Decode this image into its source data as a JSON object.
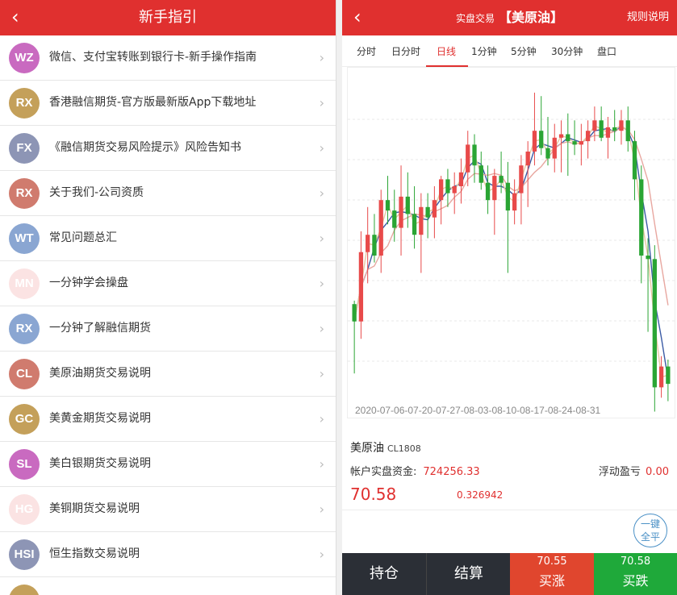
{
  "left": {
    "header": {
      "title": "新手指引"
    },
    "items": [
      {
        "abbr": "WZ",
        "color": "#c96ac0",
        "label": "微信、支付宝转账到银行卡-新手操作指南"
      },
      {
        "abbr": "RX",
        "color": "#c4a05a",
        "label": "香港融信期货-官方版最新版App下载地址"
      },
      {
        "abbr": "FX",
        "color": "#8d95b5",
        "label": "《融信期货交易风险提示》风险告知书"
      },
      {
        "abbr": "RX",
        "color": "#d07b6e",
        "label": "关于我们-公司资质"
      },
      {
        "abbr": "WT",
        "color": "#8aa6d2",
        "label": "常见问题总汇"
      },
      {
        "abbr": "MN",
        "color": "#fbe3e3",
        "label": "一分钟学会操盘"
      },
      {
        "abbr": "RX",
        "color": "#8aa6d2",
        "label": "一分钟了解融信期货"
      },
      {
        "abbr": "CL",
        "color": "#d07b6e",
        "label": "美原油期货交易说明"
      },
      {
        "abbr": "GC",
        "color": "#c4a05a",
        "label": "美黄金期货交易说明"
      },
      {
        "abbr": "SL",
        "color": "#c96ac0",
        "label": "美白银期货交易说明"
      },
      {
        "abbr": "HG",
        "color": "#fbe3e3",
        "label": "美铜期货交易说明"
      },
      {
        "abbr": "HSI",
        "color": "#8d95b5",
        "label": "恒生指数交易说明"
      },
      {
        "abbr": "",
        "color": "#c4a05a",
        "label": ""
      }
    ]
  },
  "right": {
    "header": {
      "prefix": "实盘交易",
      "product": "【美原油】",
      "rules": "规则说明"
    },
    "tabs": [
      "分时",
      "日分时",
      "日线",
      "1分钟",
      "5分钟",
      "30分钟",
      "盘口"
    ],
    "active_tab": "日线",
    "info": {
      "name": "美原油",
      "code": "CL1808",
      "funds_label": "帐户实盘资金:",
      "funds_value": "724256.33",
      "float_label": "浮动盈亏",
      "float_value": "0.00",
      "price": "70.58",
      "change": "0.326942",
      "close_all": [
        "一键",
        "全平"
      ]
    },
    "bottom": {
      "hold": "持仓",
      "settle": "结算",
      "buy_up_price": "70.55",
      "buy_up": "买涨",
      "buy_down_price": "70.58",
      "buy_down": "买跌"
    }
  },
  "chart_data": {
    "type": "candlestick",
    "x_axis_text": "2020-07-06-07-20-07-27-08-03-08-10-08-17-08-24-08-31",
    "colors": {
      "up": "#e84a4a",
      "down": "#2aa534",
      "ma_fast": "#3b5ba5",
      "ma_mid": "#e8a7a0",
      "ma_slow": "#e6c8a0"
    },
    "y_range": [
      34,
      43
    ],
    "candles": [
      [
        36.6,
        36.7,
        34.6,
        36.1
      ],
      [
        36.1,
        38.7,
        35.6,
        38.1
      ],
      [
        38.1,
        39.4,
        37.2,
        38.6
      ],
      [
        38.6,
        39.2,
        37.8,
        38.0
      ],
      [
        38.0,
        39.9,
        37.5,
        39.6
      ],
      [
        39.6,
        40.3,
        38.9,
        39.3
      ],
      [
        39.3,
        39.9,
        38.4,
        38.8
      ],
      [
        38.8,
        40.6,
        38.0,
        39.7
      ],
      [
        39.7,
        40.4,
        38.8,
        39.2
      ],
      [
        39.2,
        40.0,
        38.2,
        38.6
      ],
      [
        38.6,
        39.8,
        37.5,
        39.4
      ],
      [
        39.4,
        39.8,
        38.5,
        39.1
      ],
      [
        39.1,
        40.0,
        38.5,
        39.6
      ],
      [
        39.6,
        40.3,
        38.9,
        40.2
      ],
      [
        40.2,
        40.5,
        39.4,
        39.8
      ],
      [
        39.8,
        40.4,
        39.2,
        40.0
      ],
      [
        40.0,
        40.8,
        39.5,
        40.4
      ],
      [
        40.4,
        41.6,
        40.0,
        41.2
      ],
      [
        41.2,
        41.5,
        40.1,
        40.6
      ],
      [
        40.6,
        41.0,
        39.9,
        40.1
      ],
      [
        40.1,
        40.6,
        39.2,
        39.6
      ],
      [
        39.6,
        40.5,
        38.6,
        40.3
      ],
      [
        40.3,
        41.0,
        39.8,
        40.1
      ],
      [
        40.1,
        40.7,
        37.5,
        39.3
      ],
      [
        39.3,
        40.2,
        38.9,
        39.8
      ],
      [
        39.8,
        40.9,
        38.9,
        40.6
      ],
      [
        40.6,
        41.3,
        39.4,
        41.0
      ],
      [
        41.0,
        42.7,
        40.6,
        41.6
      ],
      [
        41.6,
        42.6,
        40.9,
        41.1
      ],
      [
        41.1,
        42.0,
        40.6,
        40.8
      ],
      [
        40.8,
        41.8,
        40.4,
        41.4
      ],
      [
        41.4,
        41.9,
        40.4,
        41.5
      ],
      [
        41.5,
        42.1,
        40.3,
        41.3
      ],
      [
        41.3,
        41.9,
        40.9,
        41.2
      ],
      [
        41.2,
        41.8,
        40.6,
        41.3
      ],
      [
        41.3,
        41.9,
        40.8,
        41.6
      ],
      [
        41.6,
        42.3,
        41.3,
        41.9
      ],
      [
        41.9,
        42.3,
        41.3,
        41.4
      ],
      [
        41.4,
        42.0,
        40.8,
        41.7
      ],
      [
        41.7,
        42.2,
        41.3,
        41.6
      ],
      [
        41.6,
        42.2,
        41.2,
        41.9
      ],
      [
        41.9,
        42.3,
        41.0,
        41.3
      ],
      [
        41.3,
        41.6,
        39.6,
        40.2
      ],
      [
        40.2,
        40.6,
        37.2,
        38.0
      ],
      [
        38.0,
        38.5,
        35.8,
        37.9
      ],
      [
        37.9,
        38.3,
        33.5,
        34.2
      ],
      [
        34.2,
        35.1,
        33.9,
        34.8
      ],
      [
        34.8,
        35.0,
        33.8,
        34.3
      ]
    ]
  }
}
